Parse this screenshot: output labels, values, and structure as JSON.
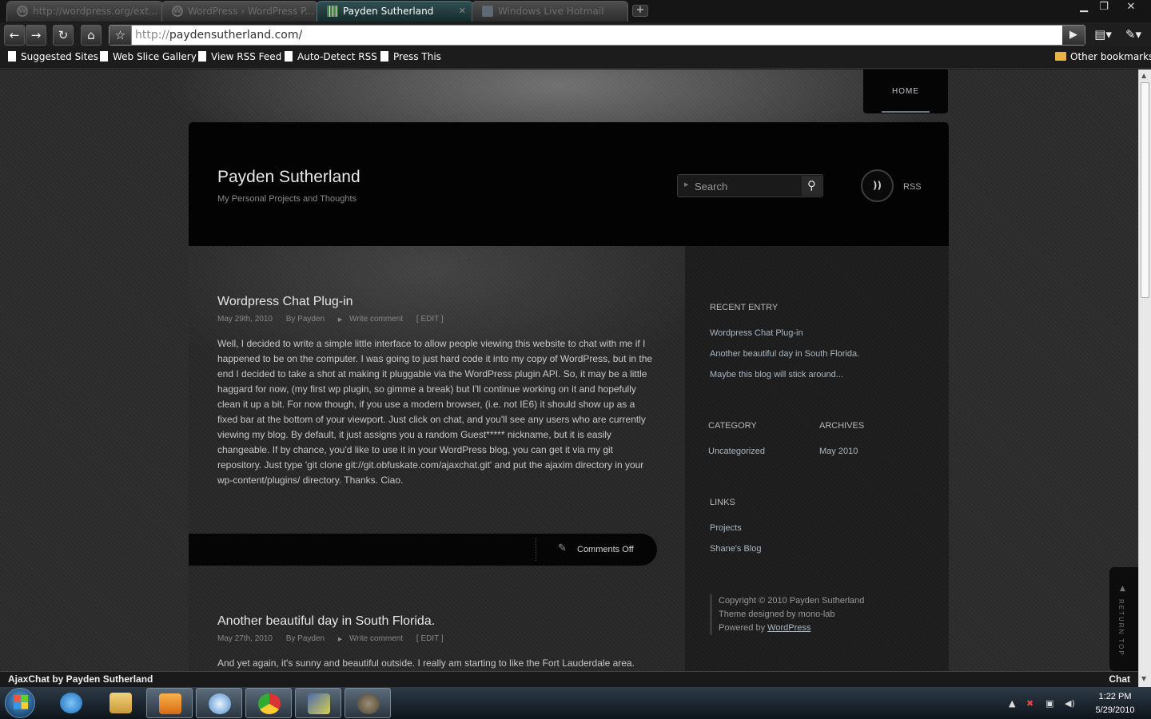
{
  "browser": {
    "tabs": [
      {
        "title": "http://wordpress.org/ext...",
        "active": false,
        "icon": "wordpress-icon"
      },
      {
        "title": "WordPress › WordPress P...",
        "active": false,
        "icon": "wordpress-icon"
      },
      {
        "title": "Payden Sutherland",
        "active": true,
        "icon": "grid-favicon"
      },
      {
        "title": "Windows Live Hotmail",
        "active": false,
        "icon": "hotmail-icon"
      }
    ],
    "url_protocol": "http://",
    "url_rest": "paydensutherland.com/",
    "bookmarks": [
      "Suggested Sites",
      "Web Slice Gallery",
      "View RSS Feed",
      "Auto-Detect RSS",
      "Press This"
    ],
    "other_bookmarks": "Other bookmarks"
  },
  "site": {
    "nav_home": "HOME",
    "title": "Payden Sutherland",
    "tagline": "My Personal Projects and Thoughts",
    "search_placeholder": "Search",
    "rss_label": "RSS"
  },
  "posts": [
    {
      "title": "Wordpress Chat Plug-in",
      "date": "May 29th, 2010",
      "author": "By Payden",
      "comment_link": "Write comment",
      "edit": "[ EDIT ]",
      "body": "Well, I decided to write  a simple little interface to allow people viewing this website to chat with me if I happened to be on the computer.  I was going to just hard code it into my copy of WordPress, but in the end I decided to take a shot at making it pluggable via the WordPress plugin API.  So, it may be a little haggard for now, (my first wp plugin, so gimme a break) but I'll continue working on it and hopefully clean it up a bit.  For now though, if you use a modern browser, (i.e. not IE6) it should show up as a fixed bar at the bottom of your viewport.  Just click on chat, and you'll see any users who are currently viewing my blog.  By default, it just assigns you a random Guest***** nickname, but it is easily changeable.  If by chance, you'd like to use it in your WordPress blog, you can get it via my git repository.  Just type 'git clone git://git.obfuskate.com/ajaxchat.git' and put the ajaxim directory in your wp-content/plugins/ directory.  Thanks.  Ciao.",
      "comments_status": "Comments Off"
    },
    {
      "title": "Another beautiful day in South Florida.",
      "date": "May 27th, 2010",
      "author": "By Payden",
      "comment_link": "Write comment",
      "edit": "[ EDIT ]",
      "body": "And yet again, it's sunny and beautiful outside.  I really am starting to like the Fort Lauderdale area."
    }
  ],
  "sidebar": {
    "recent_heading": "RECENT ENTRY",
    "recent": [
      "Wordpress Chat Plug-in",
      "Another beautiful day in South Florida.",
      "Maybe this blog will stick around..."
    ],
    "category_heading": "CATEGORY",
    "categories": [
      "Uncategorized"
    ],
    "archives_heading": "ARCHIVES",
    "archives": [
      "May 2010"
    ],
    "links_heading": "LINKS",
    "links": [
      "Projects",
      "Shane's Blog"
    ],
    "copyright": "Copyright ©  2010  Payden Sutherland",
    "designed": "Theme designed by mono-lab",
    "powered_prefix": "Powered by ",
    "powered_link": "WordPress"
  },
  "return_top": "RETURN TOP",
  "chatbar": {
    "left": "AjaxChat by Payden Sutherland",
    "right": "Chat"
  },
  "taskbar": {
    "time": "1:22 PM",
    "date": "5/29/2010"
  },
  "colors": {
    "accent_link": "#a9b8c4",
    "active_tab": "#305054"
  }
}
